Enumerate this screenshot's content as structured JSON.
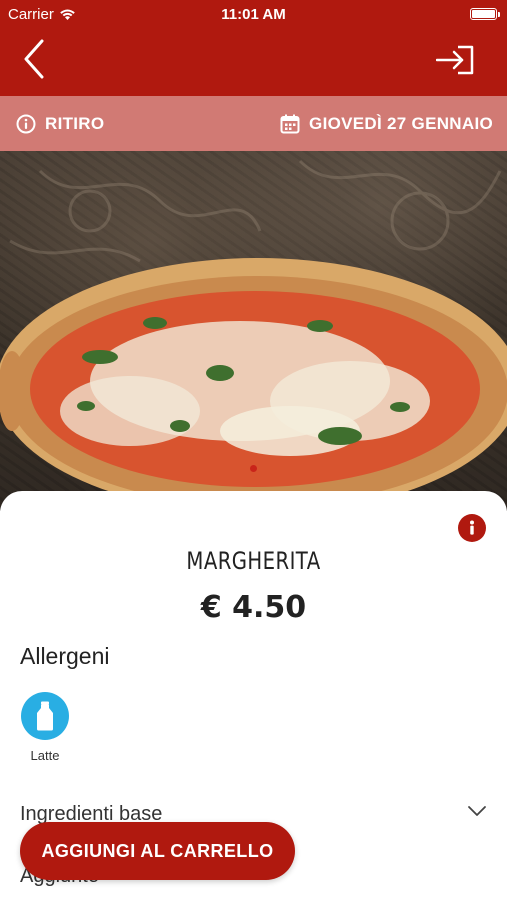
{
  "status_bar": {
    "carrier": "Carrier",
    "time": "11:01 AM"
  },
  "nav": {
    "back_icon": "chevron-left-icon",
    "login_icon": "login-icon"
  },
  "info_bar": {
    "mode_label": "RITIRO",
    "date_label": "GIOVEDÌ 27 GENNAIO"
  },
  "product": {
    "name": "MARGHERITA",
    "price": "€ 4.50"
  },
  "allergens": {
    "title": "Allergeni",
    "items": [
      {
        "label": "Latte",
        "icon": "milk-bottle-icon"
      }
    ]
  },
  "sections": {
    "base_ingredients": "Ingredienti base",
    "additions": "Aggiunte"
  },
  "cart_button": {
    "label": "AGGIUNGI AL CARRELLO"
  },
  "colors": {
    "brand": "#b0190f",
    "info_bar": "#d17a74",
    "allergen_blue": "#29aee3"
  }
}
